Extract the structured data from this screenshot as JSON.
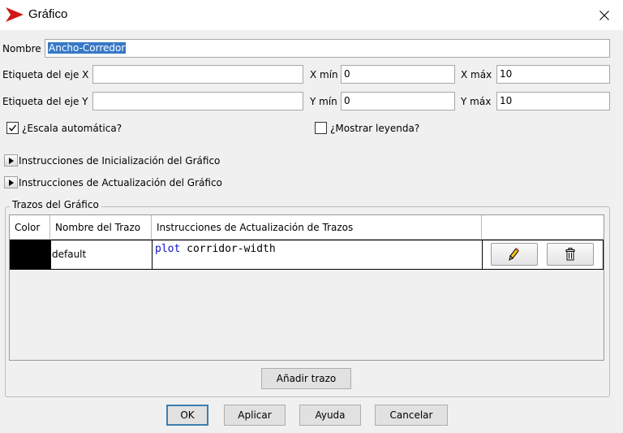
{
  "window": {
    "title": "Gráfico",
    "app_icon": "netlogo-arrow-icon",
    "close_icon": "close-icon"
  },
  "form": {
    "name_label": "Nombre",
    "name_value": "Ancho-Corredor",
    "x_axis_label": "Etiqueta del eje X",
    "x_axis_value": "",
    "y_axis_label": "Etiqueta del eje Y",
    "y_axis_value": "",
    "xmin_label": "X mín",
    "xmin_value": "0",
    "xmax_label": "X máx",
    "xmax_value": "10",
    "ymin_label": "Y mín",
    "ymin_value": "0",
    "ymax_label": "Y máx",
    "ymax_value": "10",
    "autoscale_label": "¿Escala automática?",
    "autoscale_checked": true,
    "legend_label": "¿Mostrar leyenda?",
    "legend_checked": false
  },
  "sections": {
    "setup_label": "Instrucciones de Inicialización del Gráfico",
    "update_label": "Instrucciones de Actualización del Gráfico"
  },
  "pens": {
    "group_title": "Trazos del Gráfico",
    "columns": [
      "Color",
      "Nombre del Trazo",
      "Instrucciones de Actualización de Trazos",
      ""
    ],
    "rows": [
      {
        "color": "#000000",
        "name": "default",
        "code_keyword": "plot",
        "code_rest": " corridor-width",
        "edit_icon": "pencil-icon",
        "delete_icon": "trash-icon"
      }
    ],
    "add_label": "Añadir trazo"
  },
  "buttons": {
    "ok": "OK",
    "apply": "Aplicar",
    "help": "Ayuda",
    "cancel": "Cancelar"
  }
}
